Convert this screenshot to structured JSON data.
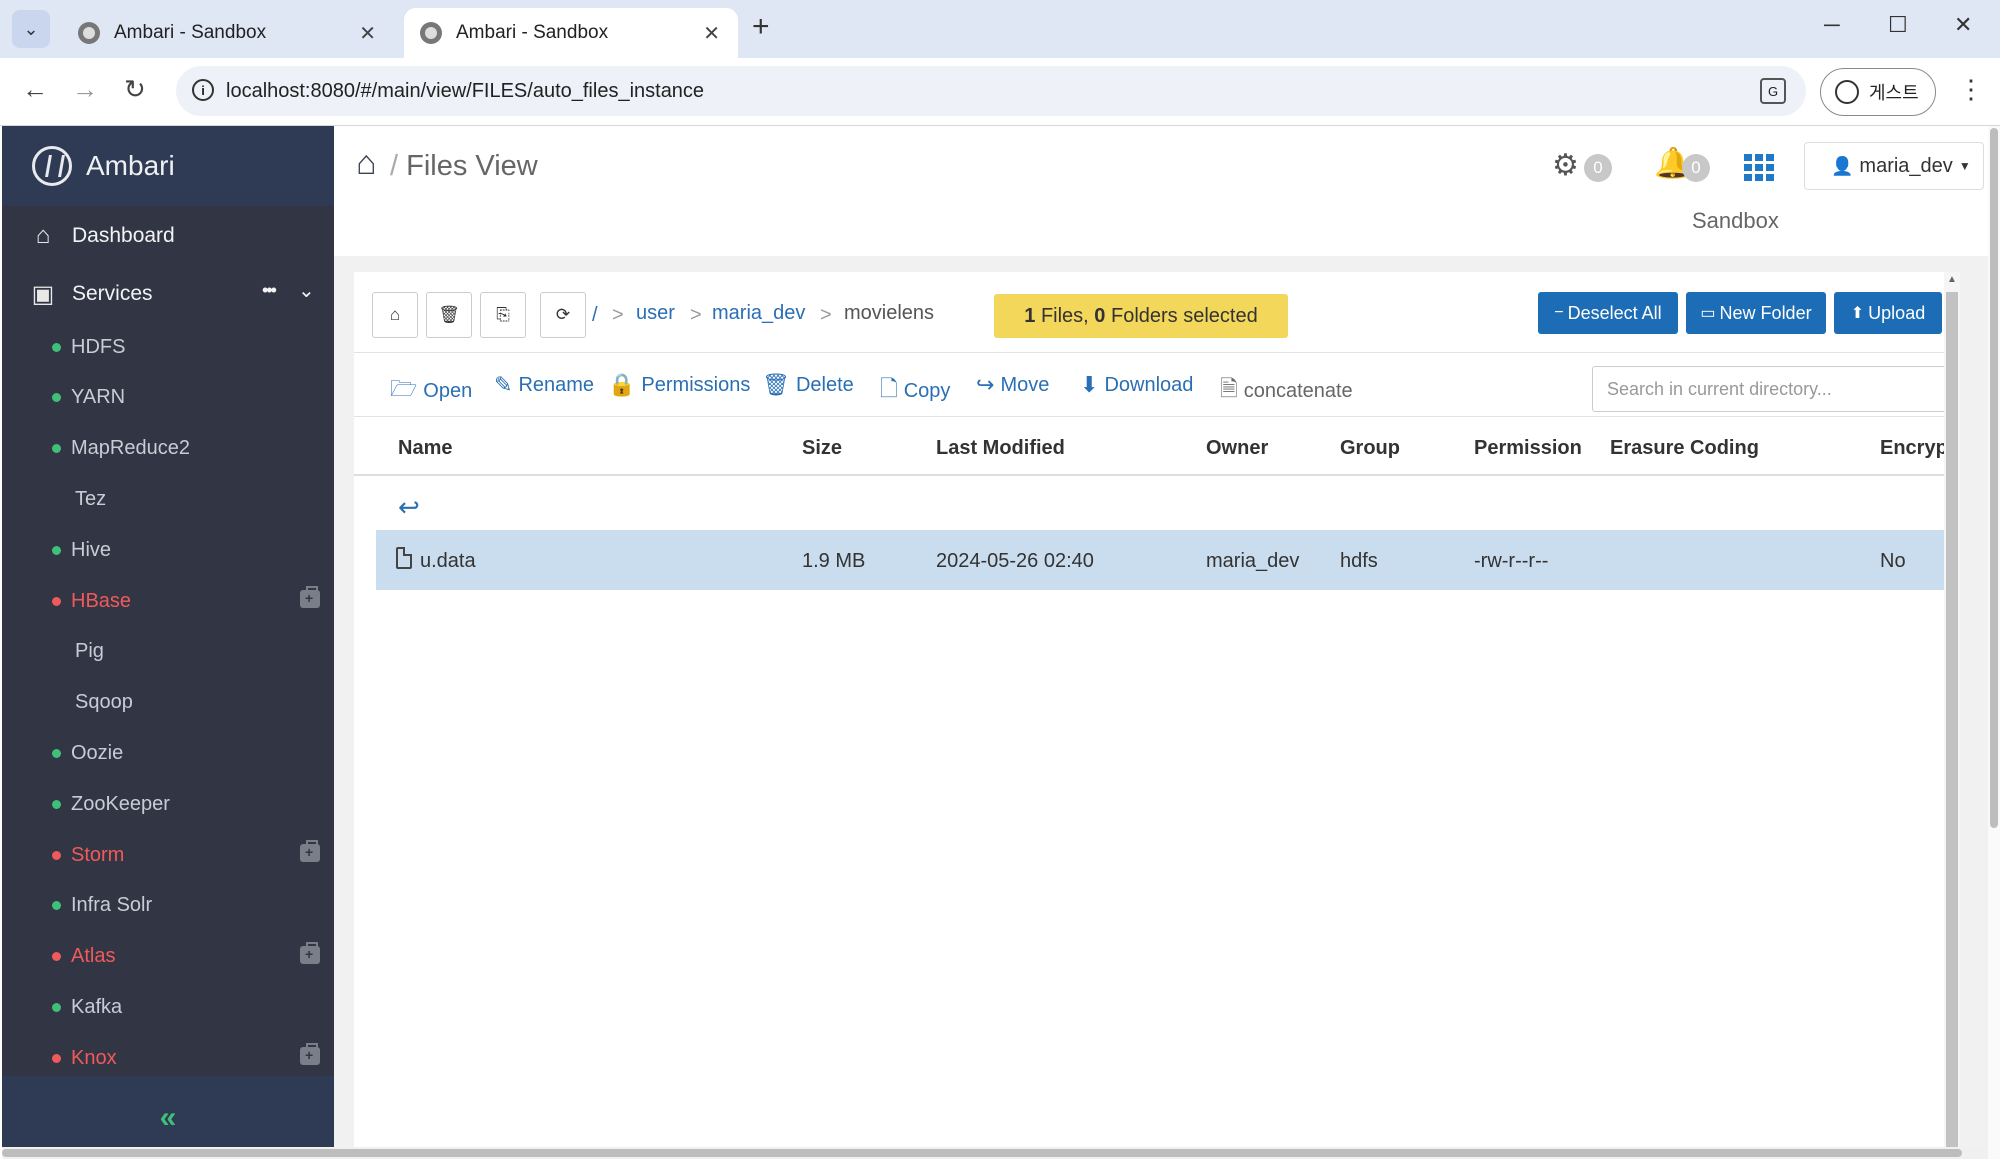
{
  "browser": {
    "tabs": [
      {
        "title": "Ambari - Sandbox",
        "active": false
      },
      {
        "title": "Ambari - Sandbox",
        "active": true
      }
    ],
    "url": "localhost:8080/#/main/view/FILES/auto_files_instance",
    "profile_label": "게스트"
  },
  "sidebar": {
    "brand": "Ambari",
    "dashboard_label": "Dashboard",
    "services_label": "Services",
    "services_more": "•••",
    "services": [
      {
        "name": "HDFS",
        "status": "green"
      },
      {
        "name": "YARN",
        "status": "green"
      },
      {
        "name": "MapReduce2",
        "status": "green"
      },
      {
        "name": "Tez",
        "status": "none"
      },
      {
        "name": "Hive",
        "status": "green"
      },
      {
        "name": "HBase",
        "status": "red",
        "maintenance": true
      },
      {
        "name": "Pig",
        "status": "none"
      },
      {
        "name": "Sqoop",
        "status": "none"
      },
      {
        "name": "Oozie",
        "status": "green"
      },
      {
        "name": "ZooKeeper",
        "status": "green"
      },
      {
        "name": "Storm",
        "status": "red",
        "maintenance": true
      },
      {
        "name": "Infra Solr",
        "status": "green"
      },
      {
        "name": "Atlas",
        "status": "red",
        "maintenance": true
      },
      {
        "name": "Kafka",
        "status": "green"
      },
      {
        "name": "Knox",
        "status": "red",
        "maintenance": true
      }
    ],
    "collapse_glyph": "«"
  },
  "header": {
    "separator": "/",
    "title": "Files View",
    "ops_count": "0",
    "alerts_count": "0",
    "user": "maria_dev",
    "cluster": "Sandbox"
  },
  "files": {
    "path_root": "/",
    "path_sep": ">",
    "path": [
      "user",
      "maria_dev",
      "movielens"
    ],
    "selection": {
      "files": "1",
      "files_label": "Files,",
      "folders": "0",
      "folders_label": "Folders selected"
    },
    "actions": {
      "deselect": "Deselect All",
      "new_folder": "New Folder",
      "upload": "Upload"
    },
    "ops": {
      "open": "Open",
      "rename": "Rename",
      "permissions": "Permissions",
      "delete": "Delete",
      "copy": "Copy",
      "move": "Move",
      "download": "Download",
      "concatenate": "concatenate"
    },
    "search_placeholder": "Search in current directory...",
    "columns": {
      "name": "Name",
      "size": "Size",
      "modified": "Last Modified",
      "owner": "Owner",
      "group": "Group",
      "permission": "Permission",
      "erasure": "Erasure Coding",
      "encryption": "Encryp"
    },
    "rows": [
      {
        "name": "u.data",
        "size": "1.9 MB",
        "modified": "2024-05-26 02:40",
        "owner": "maria_dev",
        "group": "hdfs",
        "permission": "-rw-r--r--",
        "erasure": "",
        "encrypted": "No",
        "selected": true
      }
    ]
  },
  "colors": {
    "sidebar_bg": "#323544",
    "brand_bg": "#2f3b54",
    "status_green": "#3fbf78",
    "status_red": "#f05a5a",
    "primary_button": "#1d6db6",
    "selection_bg": "#f2d75a",
    "selected_row": "#c9ddef"
  }
}
